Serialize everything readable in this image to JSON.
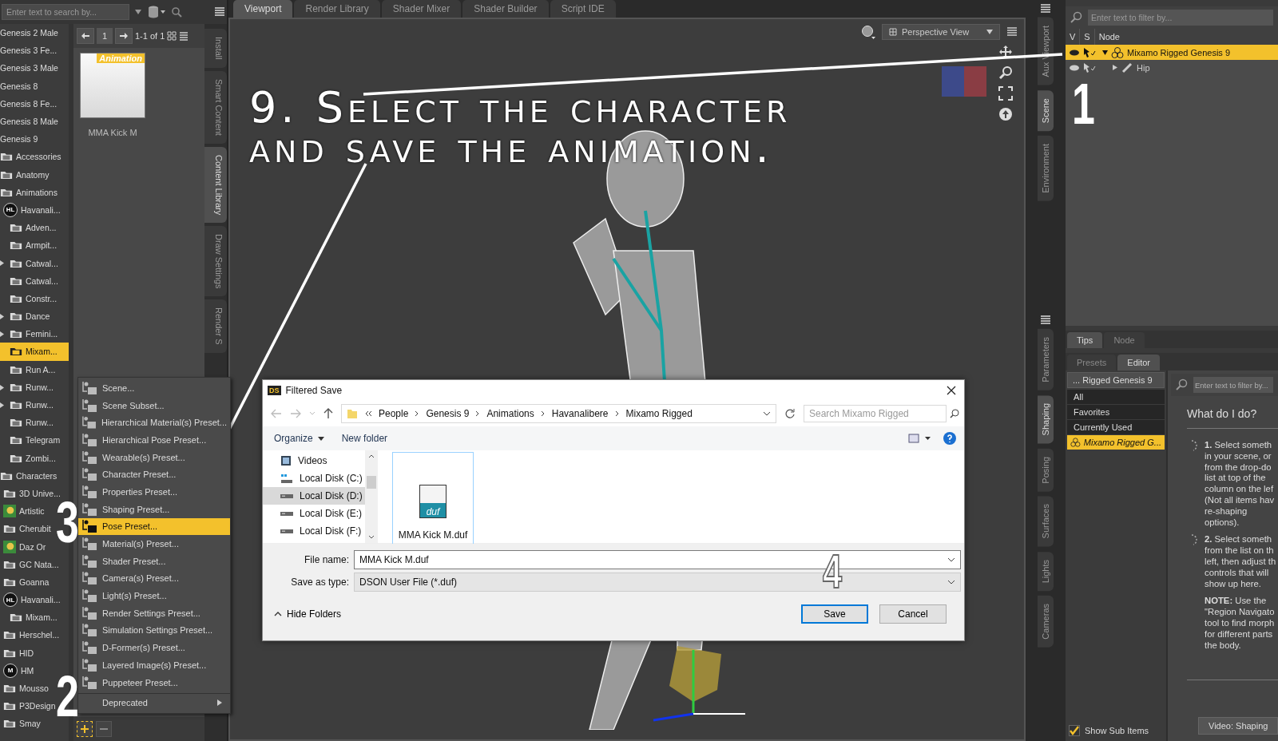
{
  "overlay": {
    "title": "9. Select the character and save the animation.",
    "steps": [
      {
        "label": "1",
        "kind": "solid"
      },
      {
        "label": "2",
        "kind": "solid"
      },
      {
        "label": "3",
        "kind": "solid"
      },
      {
        "label": "4",
        "kind": "outline"
      }
    ]
  },
  "content_library": {
    "search": {
      "placeholder": "Enter text to search by..."
    },
    "tree": [
      {
        "label": "Genesis 2 Male",
        "kind": "text",
        "selected": false,
        "collapsed": false
      },
      {
        "label": "Genesis 3 Fe...",
        "kind": "text",
        "selected": false,
        "collapsed": false
      },
      {
        "label": "Genesis 3 Male",
        "kind": "text",
        "selected": false,
        "collapsed": false
      },
      {
        "label": "Genesis 8",
        "kind": "text",
        "selected": false,
        "collapsed": false
      },
      {
        "label": "Genesis 8 Fe...",
        "kind": "text",
        "selected": false,
        "collapsed": false
      },
      {
        "label": "Genesis 8 Male",
        "kind": "text",
        "selected": false,
        "collapsed": false
      },
      {
        "label": "Genesis 9",
        "kind": "text",
        "selected": false,
        "collapsed": false
      },
      {
        "label": "Accessories",
        "kind": "folder",
        "selected": false,
        "collapsed": false
      },
      {
        "label": "Anatomy",
        "kind": "folder",
        "selected": false,
        "collapsed": false
      },
      {
        "label": "Animations",
        "kind": "folder",
        "selected": false,
        "collapsed": false,
        "children": [
          {
            "label": "Havanali...",
            "kind": "logo",
            "logo_text": "HL",
            "selected": false,
            "collapsed": false,
            "children": [
              {
                "label": "Adven...",
                "kind": "folder",
                "selected": false,
                "collapsed": false
              },
              {
                "label": "Armpit...",
                "kind": "folder",
                "selected": false,
                "collapsed": false
              },
              {
                "label": "Catwal...",
                "kind": "folder",
                "selected": false,
                "collapsed": true
              },
              {
                "label": "Catwal...",
                "kind": "folder",
                "selected": false,
                "collapsed": false
              },
              {
                "label": "Constr...",
                "kind": "folder",
                "selected": false,
                "collapsed": false
              },
              {
                "label": "Dance",
                "kind": "folder",
                "selected": false,
                "collapsed": true
              },
              {
                "label": "Femini...",
                "kind": "folder",
                "selected": false,
                "collapsed": true
              },
              {
                "label": "Mixam...",
                "kind": "folder",
                "selected": true,
                "collapsed": false
              },
              {
                "label": "Run A...",
                "kind": "folder",
                "selected": false,
                "collapsed": false
              },
              {
                "label": "Runw...",
                "kind": "folder",
                "selected": false,
                "collapsed": true
              },
              {
                "label": "Runw...",
                "kind": "folder",
                "selected": false,
                "collapsed": true
              },
              {
                "label": "Runw...",
                "kind": "folder",
                "selected": false,
                "collapsed": false
              },
              {
                "label": "Telegram",
                "kind": "folder",
                "selected": false,
                "collapsed": false
              },
              {
                "label": "Zombi...",
                "kind": "folder",
                "selected": false,
                "collapsed": false
              }
            ]
          }
        ]
      },
      {
        "label": "Characters",
        "kind": "folder",
        "selected": false,
        "collapsed": false,
        "children": [
          {
            "label": "3D Unive...",
            "kind": "folder",
            "selected": false,
            "collapsed": false
          },
          {
            "label": "Artistic",
            "kind": "picture",
            "selected": false,
            "collapsed": false
          },
          {
            "label": "Cherubit",
            "kind": "folder",
            "selected": false,
            "collapsed": false
          },
          {
            "label": "Daz Or",
            "kind": "picture",
            "selected": false,
            "collapsed": false
          },
          {
            "label": "GC Nata...",
            "kind": "folder",
            "selected": false,
            "collapsed": false
          },
          {
            "label": "Goanna",
            "kind": "folder",
            "selected": false,
            "collapsed": false
          },
          {
            "label": "Havanali...",
            "kind": "logo",
            "logo_text": "HL",
            "selected": false,
            "collapsed": false,
            "children": [
              {
                "label": "Mixam...",
                "kind": "folder",
                "selected": false,
                "collapsed": false
              }
            ]
          },
          {
            "label": "Herschel...",
            "kind": "folder",
            "selected": false,
            "collapsed": false
          },
          {
            "label": "HID",
            "kind": "folder",
            "selected": false,
            "collapsed": false
          },
          {
            "label": "HM",
            "kind": "logo",
            "logo_text": "M",
            "selected": false,
            "collapsed": false
          },
          {
            "label": "Mousso",
            "kind": "folder",
            "selected": false,
            "collapsed": false
          },
          {
            "label": "P3Design",
            "kind": "folder",
            "selected": false,
            "collapsed": false
          },
          {
            "label": "Smay",
            "kind": "folder",
            "selected": false,
            "collapsed": false
          }
        ]
      }
    ],
    "pager": {
      "page": "1",
      "range": "1-1 of 1"
    },
    "items": [
      {
        "badge": "Animation",
        "label": "MMA Kick M"
      }
    ],
    "side_tabs": [
      {
        "label": "Install",
        "selected": false
      },
      {
        "label": "Smart Content",
        "selected": false
      },
      {
        "label": "Content Library",
        "selected": true
      },
      {
        "label": "Draw Settings",
        "selected": false
      },
      {
        "label": "Render S",
        "selected": false
      }
    ]
  },
  "new_menu": {
    "items": [
      {
        "label": "Scene...",
        "selected": false,
        "submenu": false
      },
      {
        "label": "Scene Subset...",
        "selected": false,
        "submenu": false
      },
      {
        "label": "Hierarchical Material(s) Preset...",
        "selected": false,
        "submenu": false
      },
      {
        "label": "Hierarchical Pose Preset...",
        "selected": false,
        "submenu": false
      },
      {
        "label": "Wearable(s) Preset...",
        "selected": false,
        "submenu": false
      },
      {
        "label": "Character Preset...",
        "selected": false,
        "submenu": false
      },
      {
        "label": "Properties Preset...",
        "selected": false,
        "submenu": false
      },
      {
        "label": "Shaping Preset...",
        "selected": false,
        "submenu": false
      },
      {
        "label": "Pose Preset...",
        "selected": true,
        "submenu": false
      },
      {
        "label": "Material(s) Preset...",
        "selected": false,
        "submenu": false
      },
      {
        "label": "Shader Preset...",
        "selected": false,
        "submenu": false
      },
      {
        "label": "Camera(s) Preset...",
        "selected": false,
        "submenu": false
      },
      {
        "label": "Light(s) Preset...",
        "selected": false,
        "submenu": false
      },
      {
        "label": "Render Settings Preset...",
        "selected": false,
        "submenu": false
      },
      {
        "label": "Simulation Settings Preset...",
        "selected": false,
        "submenu": false
      },
      {
        "label": "D-Former(s) Preset...",
        "selected": false,
        "submenu": false
      },
      {
        "label": "Layered Image(s) Preset...",
        "selected": false,
        "submenu": false
      },
      {
        "label": "Puppeteer Preset...",
        "selected": false,
        "submenu": false
      },
      {
        "label": "Deprecated",
        "selected": false,
        "submenu": true
      }
    ]
  },
  "viewport": {
    "tabs": [
      {
        "label": "Viewport",
        "selected": true
      },
      {
        "label": "Render Library",
        "selected": false
      },
      {
        "label": "Shader Mixer",
        "selected": false
      },
      {
        "label": "Shader Builder",
        "selected": false
      },
      {
        "label": "Script IDE",
        "selected": false
      }
    ],
    "camera": "Perspective View"
  },
  "file_dialog": {
    "app_icon_text": "DS",
    "title": "Filtered Save",
    "breadcrumb": [
      "People",
      "Genesis 9",
      "Animations",
      "Havanalibere",
      "Mixamo Rigged"
    ],
    "search": {
      "placeholder": "Search Mixamo Rigged"
    },
    "toolbar": [
      "Organize",
      "New folder"
    ],
    "nav": [
      {
        "label": "Videos",
        "kind": "videos",
        "selected": false
      },
      {
        "label": "Local Disk (C:)",
        "kind": "system",
        "selected": false
      },
      {
        "label": "Local Disk (D:)",
        "kind": "disk",
        "selected": true
      },
      {
        "label": "Local Disk (E:)",
        "kind": "disk",
        "selected": false
      },
      {
        "label": "Local Disk (F:)",
        "kind": "disk",
        "selected": false
      }
    ],
    "files": [
      {
        "name": "MMA Kick M.duf",
        "icon_text": "duf",
        "selected": false
      }
    ],
    "file_name_label": "File name:",
    "file_name": "MMA Kick M.duf",
    "type_label": "Save as type:",
    "type": "DSON User File (*.duf)",
    "hide_folders": "Hide Folders",
    "buttons": [
      "Save",
      "Cancel"
    ]
  },
  "right_tabs_top": [
    {
      "label": "Aux Viewport",
      "selected": false
    },
    {
      "label": "Scene",
      "selected": true
    },
    {
      "label": "Environment",
      "selected": false
    }
  ],
  "right_tabs_bottom": [
    {
      "label": "Parameters",
      "selected": false
    },
    {
      "label": "Shaping",
      "selected": true
    },
    {
      "label": "Posing",
      "selected": false
    },
    {
      "label": "Surfaces",
      "selected": false
    },
    {
      "label": "Lights",
      "selected": false
    },
    {
      "label": "Cameras",
      "selected": false
    }
  ],
  "scene": {
    "filter": {
      "placeholder": "Enter text to filter by..."
    },
    "columns": [
      "V",
      "S",
      "Node"
    ],
    "nodes": [
      {
        "label": "Mixamo Rigged Genesis 9",
        "kind": "figure",
        "selected": true,
        "expanded": true,
        "children": [
          {
            "label": "Hip",
            "kind": "bone",
            "selected": false,
            "expanded": false
          }
        ]
      }
    ]
  },
  "info_tabs": [
    {
      "label": "Tips",
      "selected": true
    },
    {
      "label": "Node",
      "selected": false
    }
  ],
  "shaping": {
    "tabs": [
      {
        "label": "Presets",
        "selected": false
      },
      {
        "label": "Editor",
        "selected": true
      }
    ],
    "figure_select": "... Rigged Genesis 9",
    "list": [
      {
        "label": "All",
        "selected": false,
        "kind": "plain"
      },
      {
        "label": "Favorites",
        "selected": false,
        "kind": "plain"
      },
      {
        "label": "Currently Used",
        "selected": false,
        "kind": "plain"
      },
      {
        "label": "Mixamo Rigged G...",
        "selected": true,
        "kind": "figure"
      }
    ],
    "show_sub_items": {
      "label": "Show Sub Items",
      "checked": true
    },
    "filter": {
      "placeholder": "Enter text to filter by..."
    },
    "heading": "What do I do?",
    "tips": [
      "**1.** Select someth\nin your scene, or\nfrom the drop-do\nlist at top of the\ncolumn on the lef\n(Not all items hav\nre-shaping\noptions).",
      "**2.** Select someth\nfrom the list on th\nleft, then adjust th\ncontrols that will\nshow up here."
    ],
    "note": "**NOTE:** Use the\n\"Region Navigato\ntool to find morph\nfor different parts\nthe body.",
    "video_button": "Video: Shaping"
  }
}
